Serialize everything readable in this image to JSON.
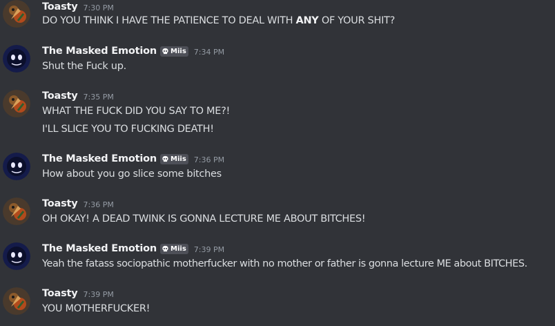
{
  "users": {
    "toasty": {
      "name": "Toasty",
      "avatar_icon": "toasty-avatar-icon",
      "name_color": "#f2f3f5"
    },
    "masked": {
      "name": "The Masked Emotion",
      "avatar_icon": "masked-emotion-avatar-icon",
      "tag_icon": "skull-icon",
      "tag": "Miis"
    }
  },
  "colors": {
    "background": "#313338",
    "message_text": "#dbdee1",
    "username": "#f2f3f5",
    "timestamp": "#949ba4",
    "tag_background": "#4e5058"
  },
  "messages": [
    {
      "author": "Toasty",
      "timestamp": "7:30 PM",
      "lines": [
        {
          "before": "DO YOU THINK I HAVE THE PATIENCE TO DEAL WITH ",
          "bold": "ANY",
          "after": " OF YOUR SHIT?"
        }
      ]
    },
    {
      "author": "The Masked Emotion",
      "tag": "Miis",
      "timestamp": "7:34 PM",
      "lines": [
        {
          "text": "Shut the Fuck up."
        }
      ]
    },
    {
      "author": "Toasty",
      "timestamp": "7:35 PM",
      "lines": [
        {
          "text": "WHAT THE FUCK DID YOU SAY TO ME?!"
        },
        {
          "text": "I'LL SLICE YOU TO FUCKING DEATH!"
        }
      ]
    },
    {
      "author": "The Masked Emotion",
      "tag": "Miis",
      "timestamp": "7:36 PM",
      "lines": [
        {
          "text": "How about you go slice some bitches"
        }
      ]
    },
    {
      "author": "Toasty",
      "timestamp": "7:36 PM",
      "lines": [
        {
          "text": "OH OKAY! A DEAD TWINK IS GONNA LECTURE ME ABOUT BITCHES!"
        }
      ]
    },
    {
      "author": "The Masked Emotion",
      "tag": "Miis",
      "timestamp": "7:39 PM",
      "lines": [
        {
          "text": "Yeah the fatass sociopathic motherfucker with no mother or father is gonna lecture ME about BITCHES."
        }
      ]
    },
    {
      "author": "Toasty",
      "timestamp": "7:39 PM",
      "lines": [
        {
          "text": "YOU MOTHERFUCKER!"
        }
      ]
    }
  ]
}
